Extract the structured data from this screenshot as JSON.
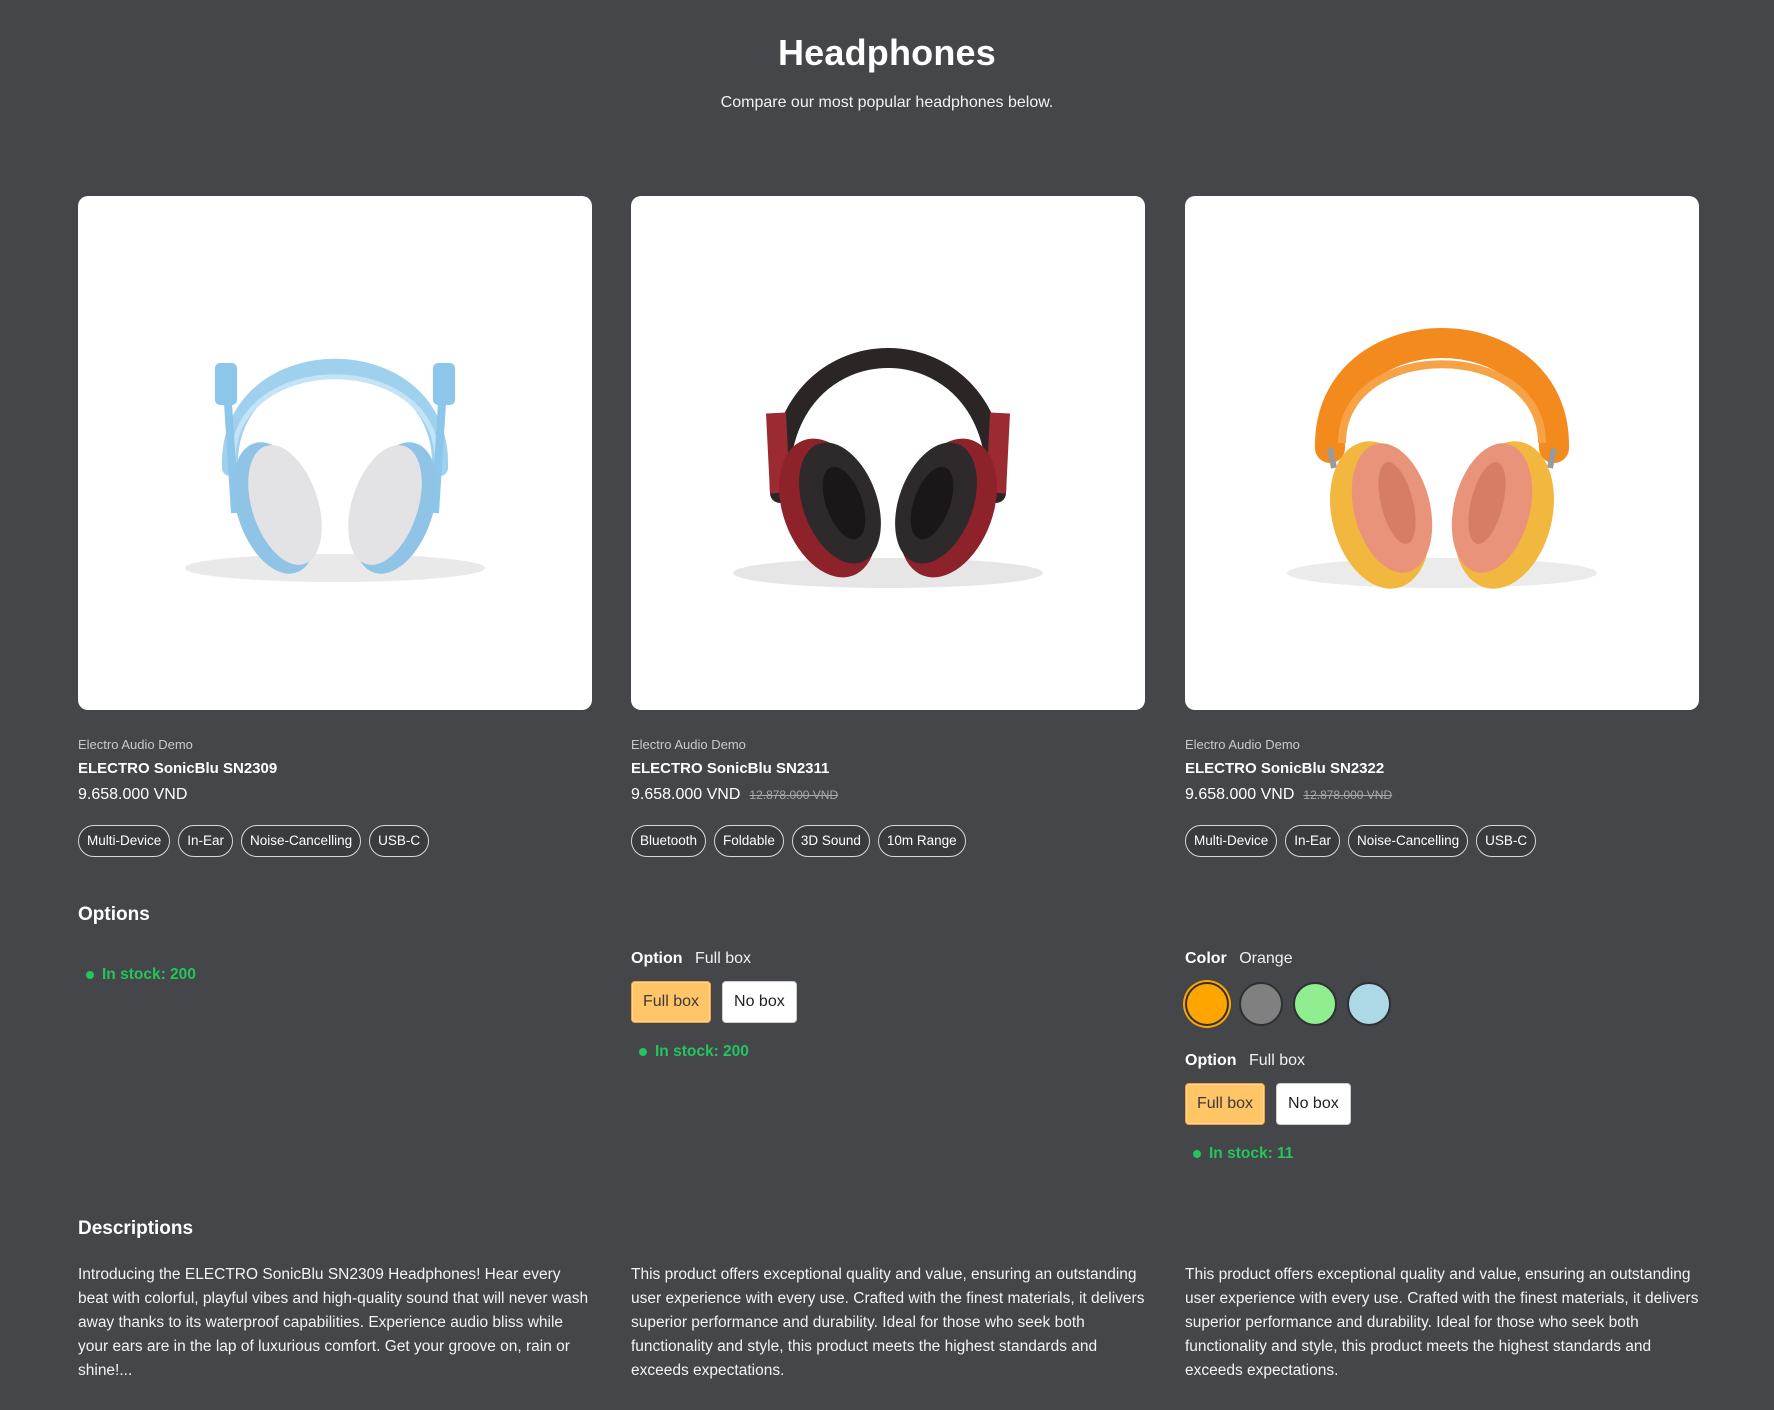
{
  "header": {
    "title": "Headphones",
    "subtitle": "Compare our most popular headphones below."
  },
  "sections": {
    "options_heading": "Options",
    "descriptions_heading": "Descriptions"
  },
  "products": [
    {
      "image_icon": "light-blue-headphones-image",
      "brand": "Electro Audio Demo",
      "name": "ELECTRO SonicBlu SN2309",
      "price": "9.658.000 VND",
      "compare_price": "",
      "tags": [
        "Multi-Device",
        "In-Ear",
        "Noise-Cancelling",
        "USB-C"
      ],
      "stock": "In stock: 200",
      "description": "Introducing the ELECTRO SonicBlu SN2309 Headphones! Hear every beat with colorful, playful vibes and high-quality sound that will never wash away thanks to its waterproof capabilities. Experience audio bliss while your ears are in the lap of luxurious comfort. Get your groove on, rain or shine!..."
    },
    {
      "image_icon": "black-red-headphones-image",
      "brand": "Electro Audio Demo",
      "name": "ELECTRO SonicBlu SN2311",
      "price": "9.658.000 VND",
      "compare_price": "12.878.000 VND",
      "tags": [
        "Bluetooth",
        "Foldable",
        "3D Sound",
        "10m Range"
      ],
      "option": {
        "label": "Option",
        "value": "Full box",
        "choices": [
          "Full box",
          "No box"
        ],
        "selected_index": 0
      },
      "stock": "In stock: 200",
      "description": "This product offers exceptional quality and value, ensuring an outstanding user experience with every use. Crafted with the finest materials, it delivers superior performance and durability. Ideal for those who seek both functionality and style, this product meets the highest standards and exceeds expectations."
    },
    {
      "image_icon": "orange-headphones-image",
      "brand": "Electro Audio Demo",
      "name": "ELECTRO SonicBlu SN2322",
      "price": "9.658.000 VND",
      "compare_price": "12.878.000 VND",
      "tags": [
        "Multi-Device",
        "In-Ear",
        "Noise-Cancelling",
        "USB-C"
      ],
      "color": {
        "label": "Color",
        "value": "Orange",
        "swatches": [
          "#ffa500",
          "#808080",
          "#90ee90",
          "#add8e6"
        ],
        "selected_index": 0
      },
      "option": {
        "label": "Option",
        "value": "Full box",
        "choices": [
          "Full box",
          "No box"
        ],
        "selected_index": 0
      },
      "stock": "In stock: 11",
      "description": "This product offers exceptional quality and value, ensuring an outstanding user experience with every use. Crafted with the finest materials, it delivers superior performance and durability. Ideal for those who seek both functionality and style, this product meets the highest standards and exceeds expectations."
    }
  ],
  "colors": {
    "background": "#45464a",
    "stock_green": "#22c55e",
    "selected_option": "#ffc566"
  }
}
